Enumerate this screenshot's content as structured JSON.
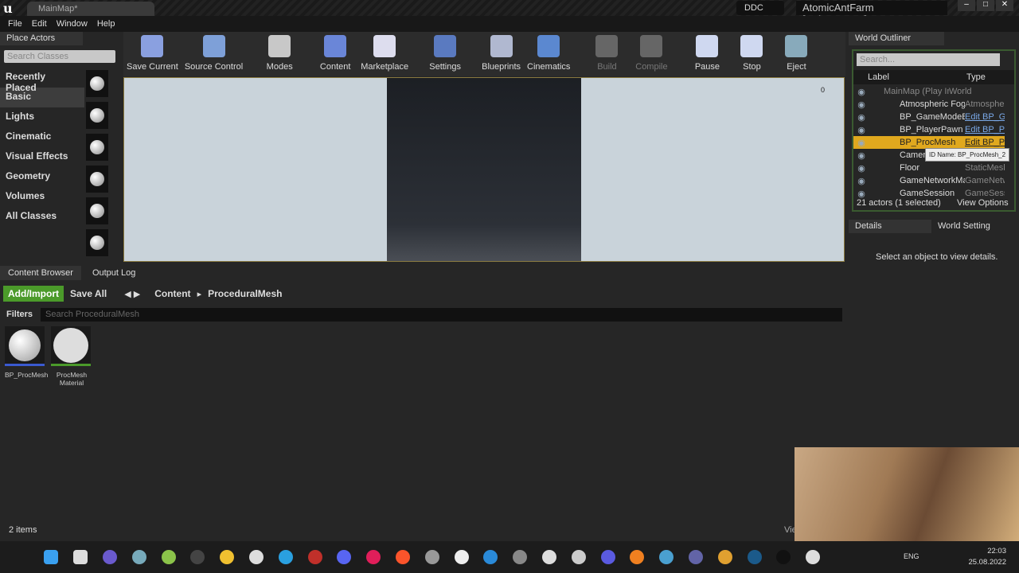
{
  "title": {
    "tab": "MainMap*",
    "ddc": "DDC",
    "project": "AtomicAntFarm [DebugGame]"
  },
  "menu": [
    "File",
    "Edit",
    "Window",
    "Help"
  ],
  "place_actors": {
    "tab": "Place Actors",
    "search_placeholder": "Search Classes",
    "categories": [
      "Recently Placed",
      "Basic",
      "Lights",
      "Cinematic",
      "Visual Effects",
      "Geometry",
      "Volumes",
      "All Classes"
    ],
    "selected": "Basic"
  },
  "toolbar": [
    {
      "label": "Save Current",
      "color": "#8aa0e0"
    },
    {
      "label": "Source Control",
      "color": "#7ea0d8"
    },
    {
      "label": "Modes",
      "color": "#c8c8c8"
    },
    {
      "label": "Content",
      "color": "#6a86d8"
    },
    {
      "label": "Marketplace",
      "color": "#dde"
    },
    {
      "label": "Settings",
      "color": "#5a7ac0"
    },
    {
      "label": "Blueprints",
      "color": "#b0b8d0"
    },
    {
      "label": "Cinematics",
      "color": "#5b88d0"
    },
    {
      "label": "Build",
      "color": "#666"
    },
    {
      "label": "Compile",
      "color": "#666"
    },
    {
      "label": "Pause",
      "color": "#cfd8f0"
    },
    {
      "label": "Stop",
      "color": "#cfd8f0"
    },
    {
      "label": "Eject",
      "color": "#8ab"
    }
  ],
  "viewport": {
    "counter": "0"
  },
  "outliner": {
    "tab": "World Outliner",
    "search_placeholder": "Search...",
    "col_label": "Label",
    "col_type": "Type",
    "rows": [
      {
        "label": "MainMap (Play In Ed",
        "type": "World"
      },
      {
        "label": "Atmospheric Fog",
        "type": "Atmospher"
      },
      {
        "label": "BP_GameModeBa",
        "type": "Edit BP_G"
      },
      {
        "label": "BP_PlayerPawn",
        "type": "Edit BP_P"
      },
      {
        "label": "BP_ProcMesh",
        "type": "Edit BP_P"
      },
      {
        "label": "Camera",
        "type": ""
      },
      {
        "label": "Floor",
        "type": "StaticMesh"
      },
      {
        "label": "GameNetworkMar",
        "type": "GameNetw"
      },
      {
        "label": "GameSession",
        "type": "GameSessi"
      }
    ],
    "tooltip": "ID Name: BP_ProcMesh_2",
    "status": "21 actors (1 selected)",
    "view_options": "View Options"
  },
  "details": {
    "tab": "Details",
    "tab2": "World Setting",
    "empty": "Select an object to view details."
  },
  "content_browser": {
    "tab": "Content Browser",
    "tab2": "Output Log",
    "add_import": "Add/Import",
    "save_all": "Save All",
    "path": [
      "Content",
      "ProceduralMesh"
    ],
    "filters": "Filters",
    "search_placeholder": "Search ProceduralMesh",
    "assets": [
      {
        "name": "BP_ProcMesh"
      },
      {
        "name": "ProcMesh Material"
      }
    ],
    "count": "2 items",
    "view_options": "View Options"
  },
  "taskbar": {
    "icons": [
      "#3aa0f0",
      "#ddd",
      "#6a5acd",
      "#7ab",
      "#8bc34a",
      "#444",
      "#f0c030",
      "#ddd",
      "#2aa0e0",
      "#c0302a",
      "#5865f2",
      "#e01e5a",
      "#fb542b",
      "#999",
      "#eee",
      "#2a8ad8",
      "#888",
      "#ddd",
      "#ccc",
      "#5a5ae0",
      "#f08020",
      "#4aa0d0",
      "#6264a7",
      "#e0a030",
      "#1b5a8a",
      "#111",
      "#ddd"
    ],
    "lang": "ENG",
    "time": "22:03",
    "date": "25.08.2022"
  }
}
